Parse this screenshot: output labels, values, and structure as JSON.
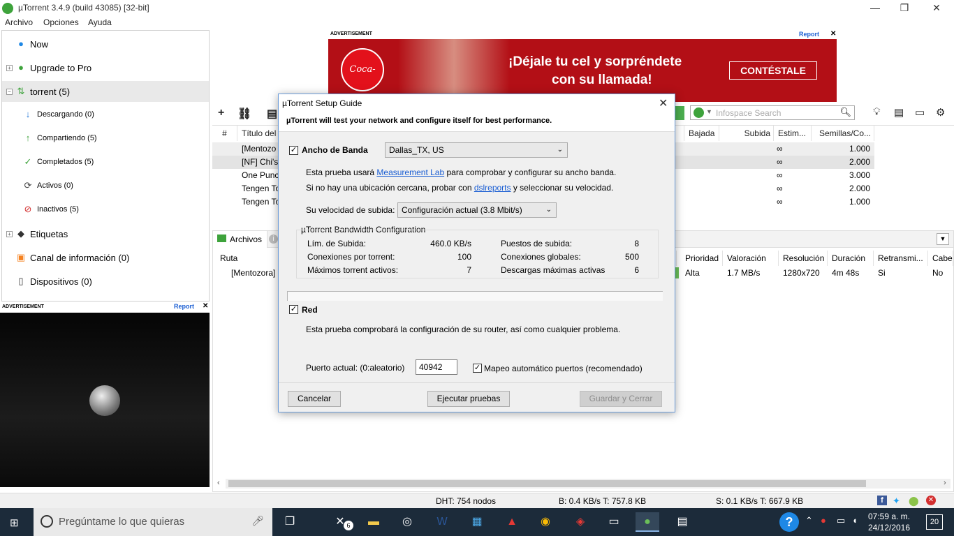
{
  "window": {
    "title": "µTorrent 3.4.9  (build 43085) [32-bit]",
    "minimize": "—",
    "restore": "❐",
    "close": "✕"
  },
  "menu": [
    "Archivo",
    "Opciones",
    "Ayuda"
  ],
  "sidebar": {
    "items": [
      {
        "label": "Now"
      },
      {
        "label": "Upgrade to Pro"
      },
      {
        "label": "torrent (5)"
      },
      {
        "label": "Descargando (0)"
      },
      {
        "label": "Compartiendo (5)"
      },
      {
        "label": "Completados (5)"
      },
      {
        "label": "Activos (0)"
      },
      {
        "label": "Inactivos (5)"
      },
      {
        "label": "Etiquetas"
      },
      {
        "label": "Canal de información (0)"
      },
      {
        "label": "Dispositivos (0)"
      }
    ],
    "ad_label": "ADVERTISEMENT",
    "ad_report": "Report",
    "ad_close": "✕"
  },
  "top_ad": {
    "label": "ADVERTISEMENT",
    "report": "Report",
    "close": "✕",
    "brand": "Coca-Cola",
    "line1": "¡Déjale tu cel y sorpréndete",
    "line2": "con su llamada!",
    "cta": "CONTÉSTALE"
  },
  "toolbar": {
    "search_placeholder": "Infospace Search"
  },
  "torrents": {
    "headers": [
      "#",
      "Título del T",
      "Bajada",
      "Subida",
      "Estim...",
      "Semillas/Co..."
    ],
    "rows": [
      {
        "name": "[Mentozo",
        "eta": "∞",
        "seeds": "1.000"
      },
      {
        "name": "[NF] Chi's",
        "eta": "∞",
        "seeds": "2.000"
      },
      {
        "name": "One Punc",
        "eta": "∞",
        "seeds": "3.000"
      },
      {
        "name": "Tengen To",
        "eta": "∞",
        "seeds": "2.000"
      },
      {
        "name": "Tengen To",
        "eta": "∞",
        "seeds": "1.000"
      }
    ]
  },
  "bottom": {
    "tab_files": "Archivos",
    "headers": [
      "Ruta",
      "Prioridad",
      "Valoración",
      "Resolución",
      "Duración",
      "Retransmi...",
      "Cabe"
    ],
    "row": {
      "path": "[Mentozora]",
      "priority": "Alta",
      "rate": "1.7 MB/s",
      "res": "1280x720",
      "dur": "4m 48s",
      "stream": "Si",
      "head": "No"
    }
  },
  "status": {
    "dht": "DHT: 754 nodos",
    "down": "B: 0.4 KB/s T: 757.8 KB",
    "up": "S: 0.1 KB/s T: 667.9 KB"
  },
  "taskbar": {
    "search": "Pregúntame lo que quieras",
    "time": "07:59 a. m.",
    "date": "24/12/2016",
    "notifications": "20",
    "xbox_badge": "6"
  },
  "dialog": {
    "title": "µTorrent Setup Guide",
    "subtitle": "µTorrent will test your network and configure itself for best performance.",
    "bandwidth": {
      "label": "Ancho de Banda",
      "checked": true,
      "location": "Dallas_TX, US",
      "text1_pre": "Esta prueba usará ",
      "text1_link": "Measurement Lab",
      "text1_post": " para comprobar y configurar su ancho banda.",
      "text2_pre": "Si no hay una ubicación cercana, probar con ",
      "text2_link": "dslreports",
      "text2_post": " y seleccionar su velocidad.",
      "upload_label": "Su velocidad de subida:",
      "upload_value": "Configuración actual (3.8 Mbit/s)"
    },
    "config": {
      "title": "µTorrent Bandwidth Configuration",
      "left": [
        {
          "k": "Lím. de Subida:",
          "v": "460.0 KB/s"
        },
        {
          "k": "Conexiones por torrent:",
          "v": "100"
        },
        {
          "k": "Máximos torrent activos:",
          "v": "7"
        }
      ],
      "right": [
        {
          "k": "Puestos de subida:",
          "v": "8"
        },
        {
          "k": "Conexiones globales:",
          "v": "500"
        },
        {
          "k": "Descargas máximas activas",
          "v": "6"
        }
      ]
    },
    "network": {
      "label": "Red",
      "checked": true,
      "text": "Esta prueba comprobará la configuración de su router, así como cualquier problema.",
      "port_label": "Puerto actual: (0:aleatorio)",
      "port_value": "40942",
      "auto_map": "Mapeo automático puertos (recomendado)",
      "auto_checked": true
    },
    "buttons": {
      "cancel": "Cancelar",
      "run": "Ejecutar pruebas",
      "save": "Guardar y Cerrar"
    }
  }
}
